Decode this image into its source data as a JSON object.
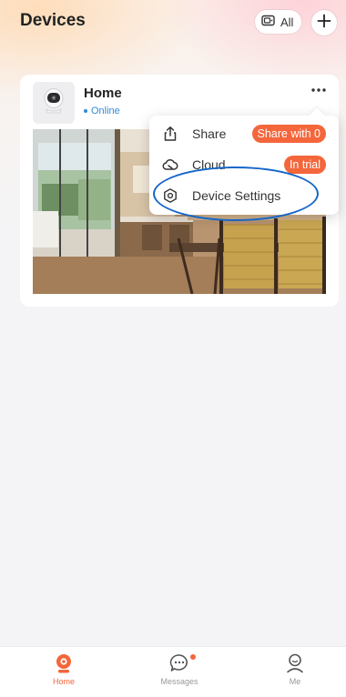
{
  "header": {
    "title": "Devices",
    "filter_label": "All",
    "filter_icon": "camera-list-icon",
    "add_icon": "plus-icon"
  },
  "device_card": {
    "name": "Home",
    "status": "Online",
    "more_icon": "more-dots-icon",
    "thumbnail_icon": "camera-icon",
    "preview_desc": "live-preview-image"
  },
  "popup_menu": {
    "items": [
      {
        "label": "Share",
        "icon": "share-icon",
        "badge": "Share with 0"
      },
      {
        "label": "Cloud",
        "icon": "cloud-icon",
        "badge": "In trial"
      },
      {
        "label": "Device Settings",
        "icon": "settings-icon",
        "badge": ""
      }
    ]
  },
  "tabs": [
    {
      "label": "Home",
      "icon": "home-camera-icon",
      "active": true
    },
    {
      "label": "Messages",
      "icon": "message-icon",
      "active": false
    },
    {
      "label": "Me",
      "icon": "user-icon",
      "active": false
    }
  ],
  "colors": {
    "accent": "#f4663b",
    "online": "#2f8ad6",
    "highlight": "#1466c8"
  }
}
